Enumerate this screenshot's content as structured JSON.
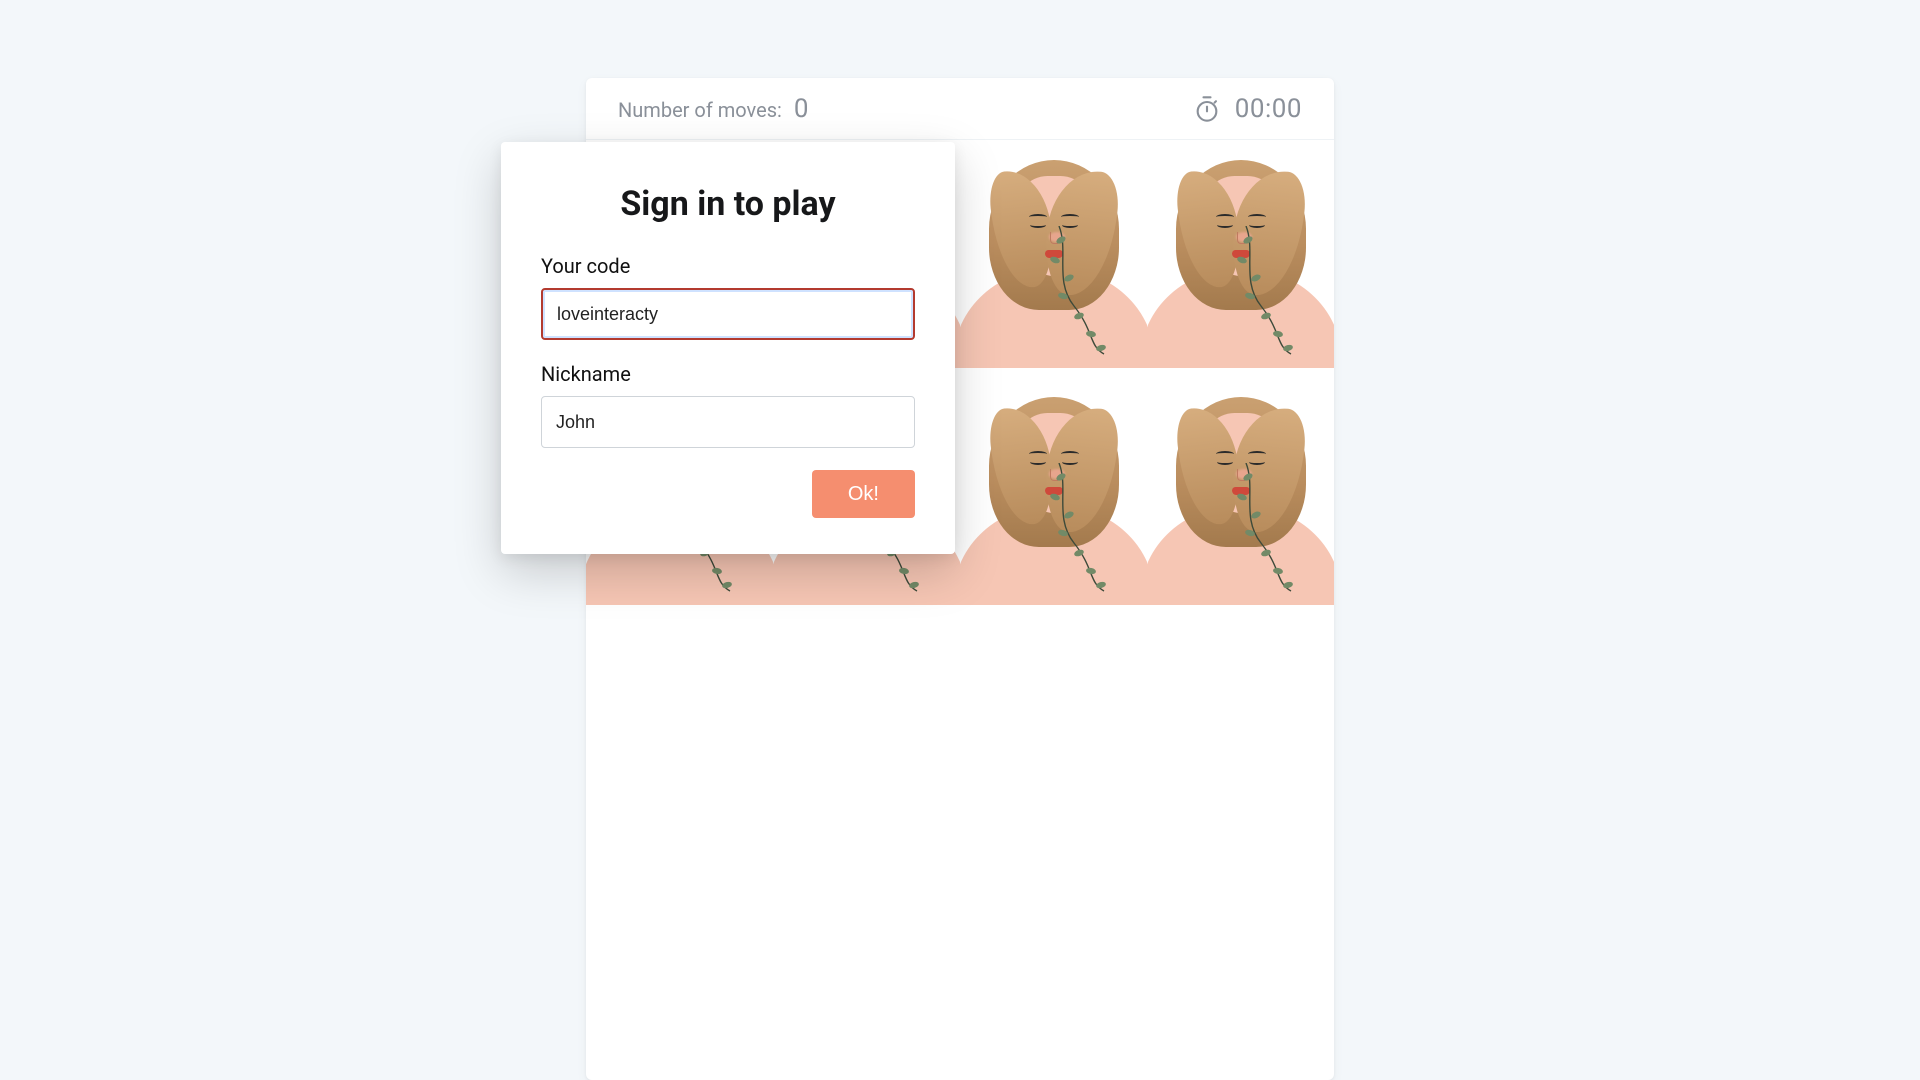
{
  "header": {
    "moves_label": "Number of moves:",
    "moves_count": "0",
    "time": "00:00"
  },
  "modal": {
    "title": "Sign in to play",
    "code_label": "Your code",
    "code_value": "loveinteracty",
    "nickname_label": "Nickname",
    "nickname_value": "John",
    "ok_label": "Ok!"
  },
  "grid": {
    "rows": 2,
    "cols": 4,
    "card_image": "portrait-with-vines"
  },
  "colors": {
    "accent": "#f58e6f",
    "focus_border": "#b33a2f",
    "focus_inner": "#cfe2ff",
    "muted_text": "#8a9099"
  }
}
